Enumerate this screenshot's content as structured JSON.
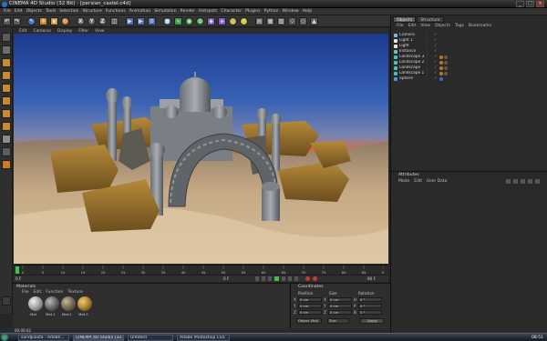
{
  "window": {
    "title": "CINEMA 4D Studio (32 Bit) - [persian_castel.c4d]",
    "buttons": [
      "_",
      "□",
      "×"
    ]
  },
  "menubar": [
    "File",
    "Edit",
    "Objects",
    "Tools",
    "Selection",
    "Structure",
    "Functions",
    "Animation",
    "Simulation",
    "Render",
    "Hotspots",
    "Character",
    "Plugins",
    "Python",
    "Window",
    "Help"
  ],
  "toolbar": {
    "axis_x": "X",
    "axis_y": "Y",
    "axis_z": "Z"
  },
  "viewport": {
    "menu": [
      "Edit",
      "Cameras",
      "Display",
      "Filter",
      "View"
    ]
  },
  "timeline": {
    "ticks": [
      "0",
      "5",
      "10",
      "15",
      "20",
      "25",
      "30",
      "35",
      "40",
      "45",
      "50",
      "55",
      "60",
      "65",
      "70",
      "75",
      "80",
      "85",
      "90"
    ],
    "frame_field": "0 F",
    "end_field": "90 F",
    "current_frame": "0 F"
  },
  "object_manager": {
    "tabs": [
      "Objects",
      "Structure"
    ],
    "menu": [
      "File",
      "Edit",
      "View",
      "Objects",
      "Tags",
      "Bookmarks"
    ],
    "objects": [
      {
        "name": "Camera",
        "tags": []
      },
      {
        "name": "Light 1",
        "tags": []
      },
      {
        "name": "Light",
        "tags": []
      },
      {
        "name": "Instance",
        "tags": []
      },
      {
        "name": "Landscape 3",
        "tags": [
          "#b07a2f",
          "#6d5a3a"
        ]
      },
      {
        "name": "Landscape 2",
        "tags": [
          "#b07a2f",
          "#6d5a3a"
        ]
      },
      {
        "name": "Landscape",
        "tags": [
          "#b07a2f",
          "#6d5a3a"
        ]
      },
      {
        "name": "Landscape 1",
        "tags": [
          "#b07a2f",
          "#6d5a3a"
        ]
      },
      {
        "name": "Sphere",
        "tags": [
          "#3a6ad6"
        ]
      }
    ]
  },
  "attributes": {
    "title": "Attributes",
    "menu": [
      "Mode",
      "Edit",
      "User Data"
    ]
  },
  "materials": {
    "title": "Materials",
    "menu": [
      "File",
      "Edit",
      "Function",
      "Texture"
    ],
    "items": [
      {
        "label": "Mat",
        "color": "#a8a8a8"
      },
      {
        "label": "Mat.1",
        "color": "#6d6d6d"
      },
      {
        "label": "Mat.2",
        "color": "#7a6f58"
      },
      {
        "label": "Mat.3",
        "color": "#b08a3a"
      }
    ]
  },
  "coordinates": {
    "title": "Coordinates",
    "col_headers": [
      "Position",
      "Size",
      "Rotation"
    ],
    "rows": [
      {
        "axis": "X",
        "pos": "0 cm",
        "size": "0 cm",
        "rot_label": "H",
        "rot": "0 °"
      },
      {
        "axis": "Y",
        "pos": "0 cm",
        "size": "0 cm",
        "rot_label": "P",
        "rot": "0 °"
      },
      {
        "axis": "Z",
        "pos": "0 cm",
        "size": "0 cm",
        "rot_label": "B",
        "rot": "0 °"
      }
    ],
    "mode_left": "Object (Rel)",
    "mode_mid": "Size",
    "apply_label": "Apply"
  },
  "status": {
    "time": "00:00:42"
  },
  "taskbar": {
    "tasks": [
      "sandpiasta - Adobe...",
      "CINEMA 4D Studio (32...",
      "Untitled",
      "Adobe Photoshop CS5"
    ],
    "clock": "08:51"
  },
  "colors": {
    "accent": "#2a6fc9",
    "sky_top": "#1a3a8e",
    "horizon": "#e36a35",
    "sand": "#c9ad7e"
  }
}
